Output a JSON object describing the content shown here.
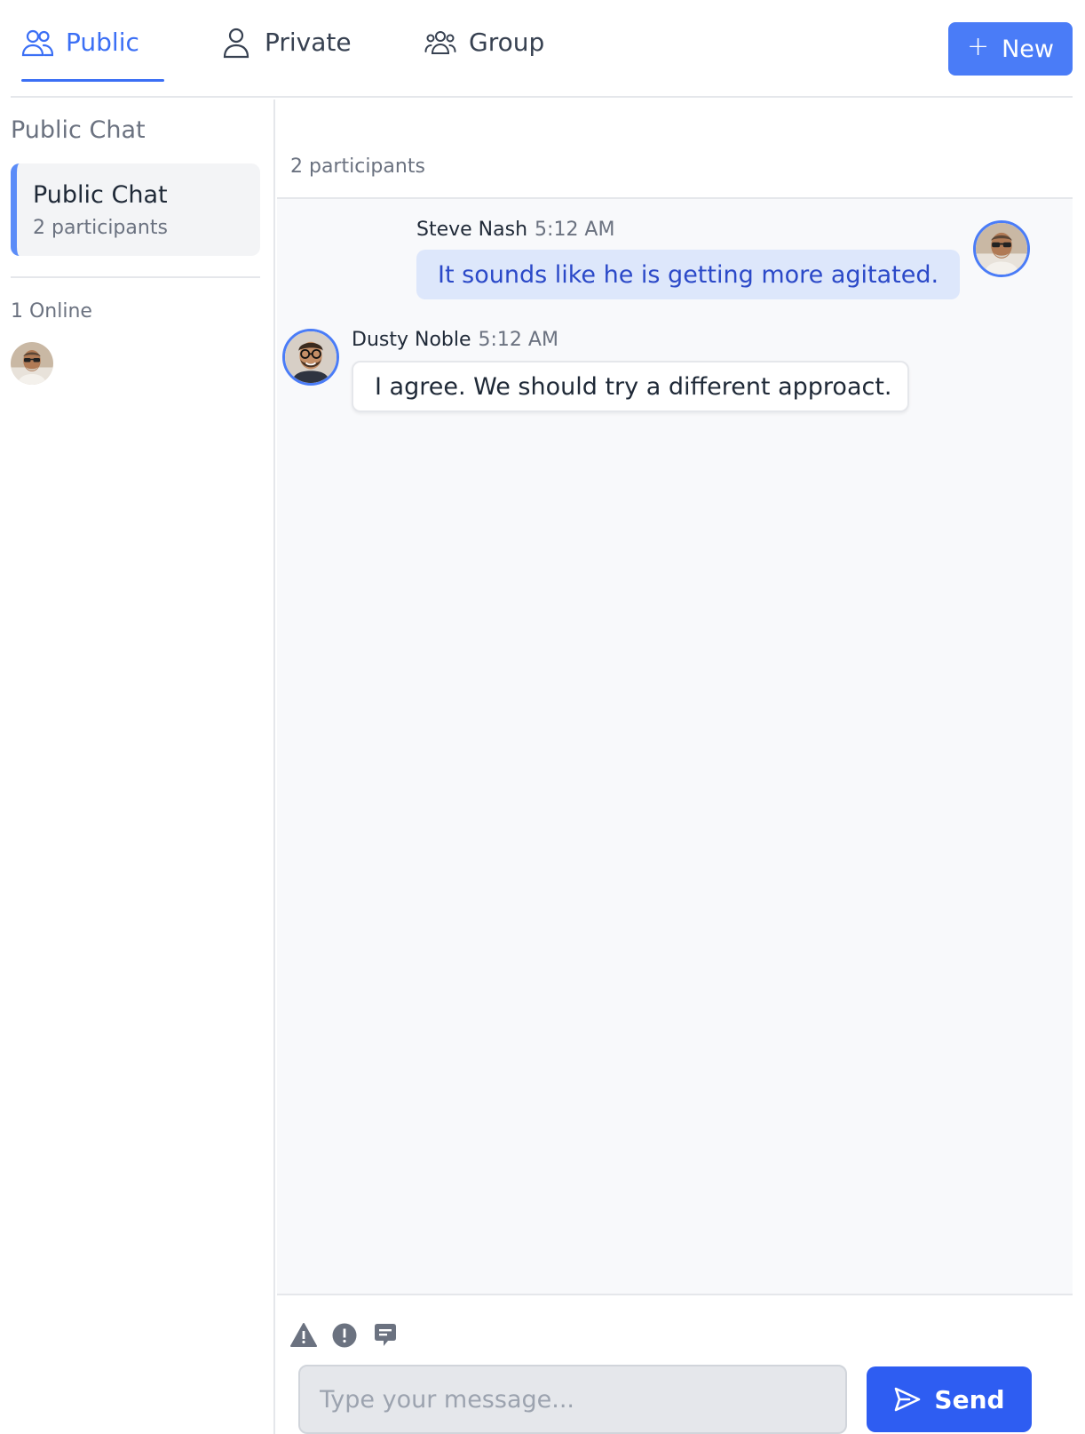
{
  "tabs": [
    {
      "label": "Public",
      "icon": "users-icon",
      "active": true
    },
    {
      "label": "Private",
      "icon": "user-icon",
      "active": false
    },
    {
      "label": "Group",
      "icon": "user-group-icon",
      "active": false
    }
  ],
  "new_button": {
    "label": "New",
    "icon": "plus-icon"
  },
  "sidebar": {
    "heading": "Public Chat",
    "chats": [
      {
        "title": "Public Chat",
        "subtitle": "2 participants",
        "selected": true
      }
    ],
    "online_label": "1 Online"
  },
  "chat": {
    "participants": "2 participants",
    "messages": [
      {
        "sender": "Steve Nash",
        "time": "5:12 AM",
        "text": "It sounds like he is getting more agitated.",
        "own": true
      },
      {
        "sender": "Dusty Noble",
        "time": "5:12 AM",
        "text": "I agree. We should try a different approact.",
        "own": false
      }
    ]
  },
  "composer": {
    "tools": [
      "warning-icon",
      "exclamation-circle-icon",
      "chat-bubble-icon"
    ],
    "placeholder": "Type your message...",
    "send_label": "Send"
  },
  "colors": {
    "accent": "#3b6ff5",
    "button": "#4a7cf7",
    "send_button": "#2e5df2",
    "own_bubble": "#dde7fb",
    "own_text": "#2b49c8",
    "chat_background": "#f8f9fb"
  }
}
